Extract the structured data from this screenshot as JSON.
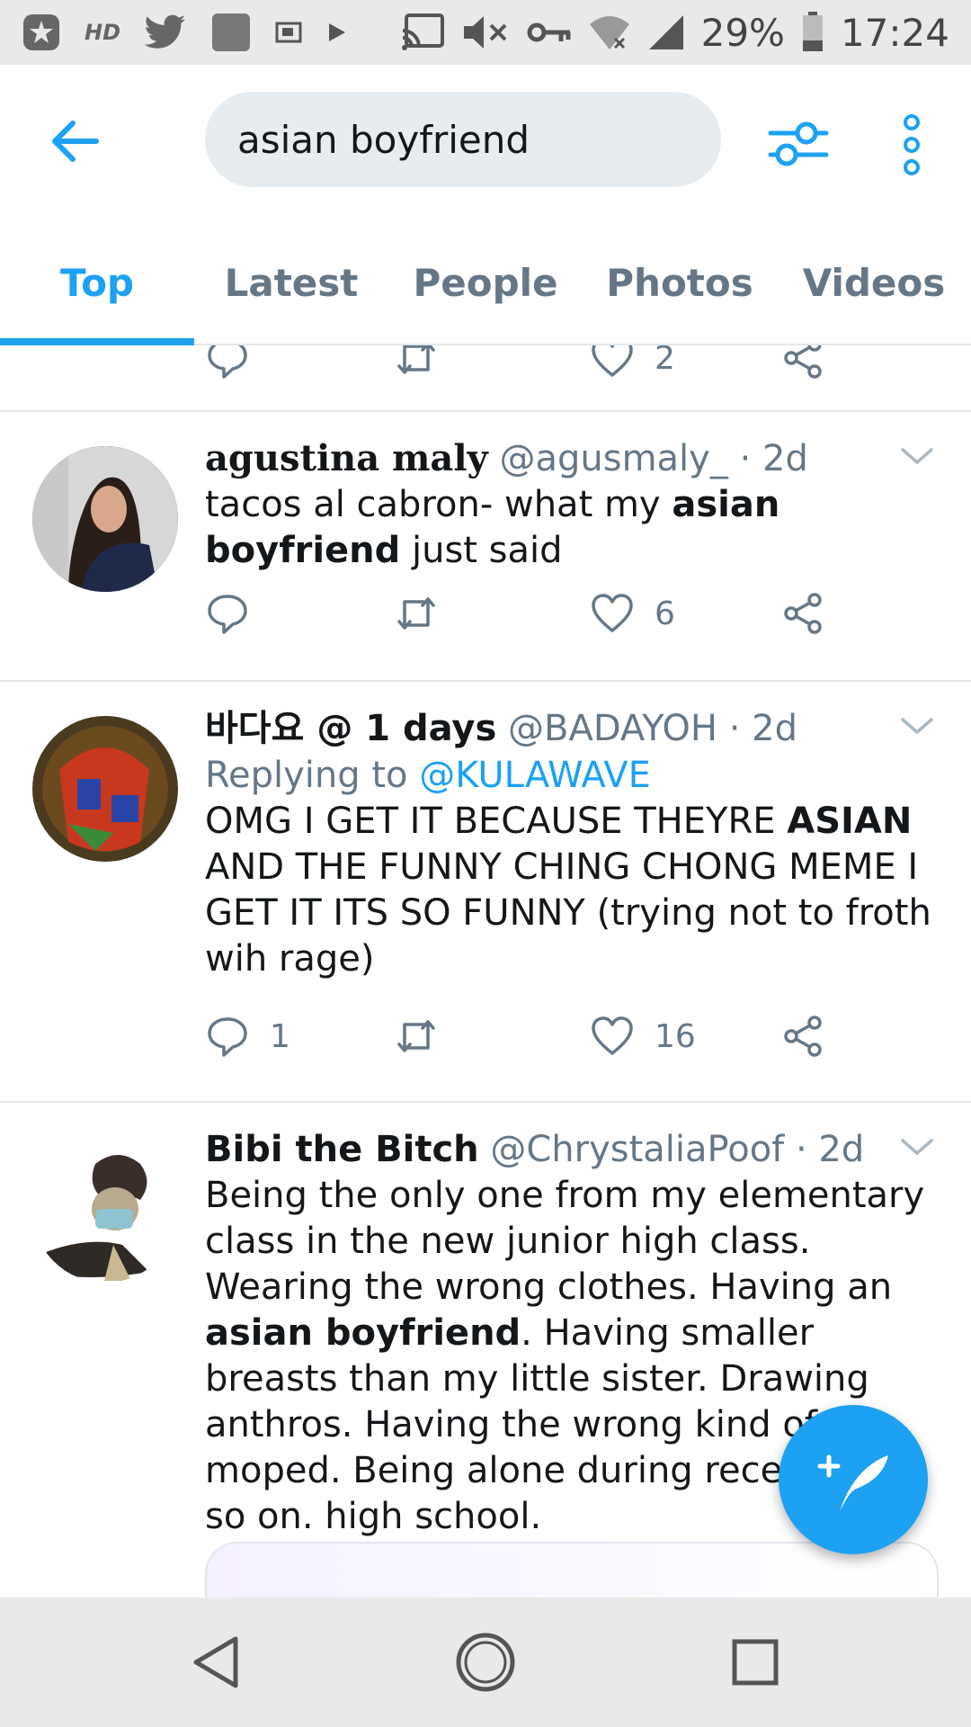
{
  "status_bar": {
    "hd_label": "HD",
    "battery": "29%",
    "time": "17:24"
  },
  "header": {
    "search_query": "asian boyfriend"
  },
  "tabs": [
    {
      "label": "Top",
      "active": true
    },
    {
      "label": "Latest",
      "active": false
    },
    {
      "label": "People",
      "active": false
    },
    {
      "label": "Photos",
      "active": false
    },
    {
      "label": "Videos",
      "active": false
    }
  ],
  "partial_tweet": {
    "like_count": "2"
  },
  "tweets": [
    {
      "display_name": "agustina maly",
      "handle": "@agusmaly_",
      "separator": "·",
      "time": "2d",
      "reply_prefix": "",
      "reply_to": "",
      "text_parts": [
        "tacos al cabron- what my ",
        "asian boyfriend",
        " just said"
      ],
      "reply_count": "",
      "like_count": "6"
    },
    {
      "display_name": "바다요 @ 1 days",
      "handle": "@BADAYOH",
      "separator": "·",
      "time": "2d",
      "reply_prefix": "Replying to ",
      "reply_to": "@KULAWAVE",
      "text_parts": [
        "OMG I GET IT BECAUSE THEYRE ",
        "ASIAN",
        " AND THE FUNNY CHING CHONG MEME I GET IT ITS SO FUNNY (trying not to froth wih rage)"
      ],
      "reply_count": "1",
      "like_count": "16"
    },
    {
      "display_name": "Bibi the Bitch",
      "handle": "@ChrystaliaPoof",
      "separator": "·",
      "time": "2d",
      "reply_prefix": "",
      "reply_to": "",
      "text_parts": [
        "Being the only one from my elementary class in the new junior high class. Wearing the wrong clothes. Having an ",
        "asian boyfriend",
        ". Having smaller breasts than my little sister. Drawing anthros. Having the wrong kind of moped. Being alone during recess. And so on. ",
        "high school."
      ],
      "reply_count": "",
      "like_count": ""
    }
  ],
  "colors": {
    "accent": "#1da1f2",
    "secondary_text": "#657786",
    "divider": "#e1e8ed",
    "search_bg": "#e6ecf0"
  }
}
